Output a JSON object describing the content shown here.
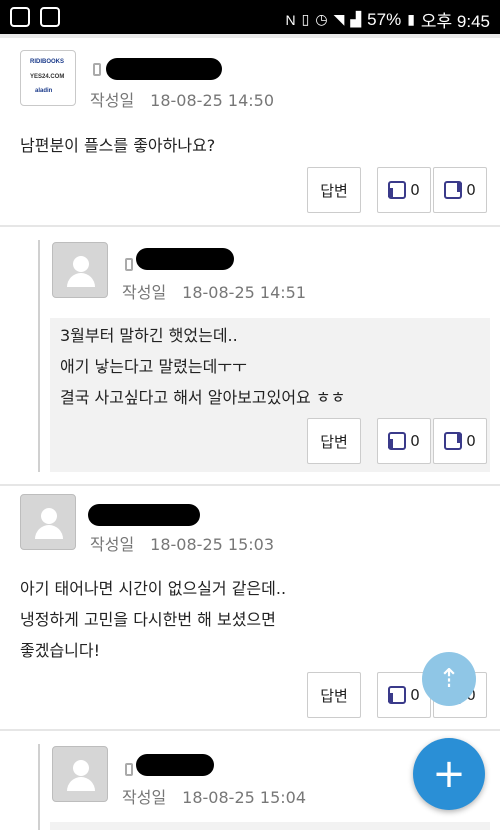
{
  "status_bar": {
    "battery": "57%",
    "time": "오후 9:45"
  },
  "avatar_logo": {
    "line1": "RIDIBOOKS",
    "line2": "YES24.COM",
    "line3": "aladin"
  },
  "posts": [
    {
      "meta_label": "작성일",
      "date": "18-08-25 14:50",
      "lines": [
        "남편분이 플스를 좋아하나요?"
      ],
      "reply_label": "답변",
      "likes": "0",
      "dislikes": "0"
    },
    {
      "meta_label": "작성일",
      "date": "18-08-25 14:51",
      "lines": [
        "3월부터 말하긴 햇었는데..",
        "애기 낳는다고 말렸는데ㅜㅜ",
        "결국 사고싶다고 해서 알아보고있어요 ㅎㅎ"
      ],
      "reply_label": "답변",
      "likes": "0",
      "dislikes": "0"
    },
    {
      "meta_label": "작성일",
      "date": "18-08-25 15:03",
      "lines": [
        "아기 태어나면 시간이 없으실거 같은데..",
        "냉정하게 고민을 다시한번 해 보셨으면",
        "좋겠습니다!"
      ],
      "reply_label": "답변",
      "likes": "0",
      "dislikes": "0"
    },
    {
      "meta_label": "작성일",
      "date": "18-08-25 15:04"
    }
  ],
  "fab": {
    "scroll_top_label": "⇡",
    "add_label": "+"
  }
}
